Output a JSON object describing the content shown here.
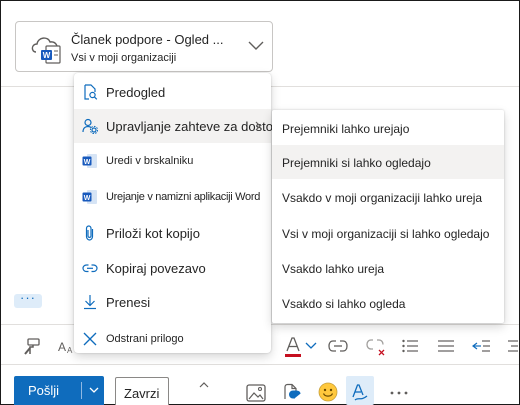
{
  "attachment": {
    "title": "Članek podpore - Ogled ...",
    "subtitle": "Vsi v moji organizaciji",
    "file_icon": "cloud-word-file-icon",
    "dropdown_icon": "chevron-down-icon"
  },
  "menu": {
    "items": [
      {
        "label": "Predogled",
        "icon": "preview-icon"
      },
      {
        "label": "Upravljanje zahteve za dostop",
        "icon": "manage-access-icon"
      },
      {
        "label": "Uredi v brskalniku",
        "icon": "word-icon"
      },
      {
        "label": "Urejanje v namizni aplikaciji Word",
        "icon": "word-icon"
      },
      {
        "label": "Priloži kot kopijo",
        "icon": "paperclip-icon"
      },
      {
        "label": "Kopiraj povezavo",
        "icon": "link-icon"
      },
      {
        "label": "Prenesi",
        "icon": "download-icon"
      },
      {
        "label": "Odstrani prilogo",
        "icon": "close-icon"
      }
    ]
  },
  "submenu": {
    "items": [
      {
        "label": "Prejemniki lahko urejajo"
      },
      {
        "label": "Prejemniki si lahko ogledajo"
      },
      {
        "label": "Vsakdo v moji organizaciji lahko ureja"
      },
      {
        "label": "Vsi v moji organizaciji si lahko ogledajo"
      },
      {
        "label": "Vsakdo lahko ureja"
      },
      {
        "label": "Vsakdo si lahko ogleda"
      }
    ]
  },
  "more_label": "···",
  "compose": {
    "send_label": "Pošlji",
    "discard_label": "Zavrzi"
  },
  "colors": {
    "accent": "#0f6cbd",
    "word_blue": "#185abd",
    "font_color_red": "#c50f1f",
    "hover": "#f3f2f1"
  }
}
